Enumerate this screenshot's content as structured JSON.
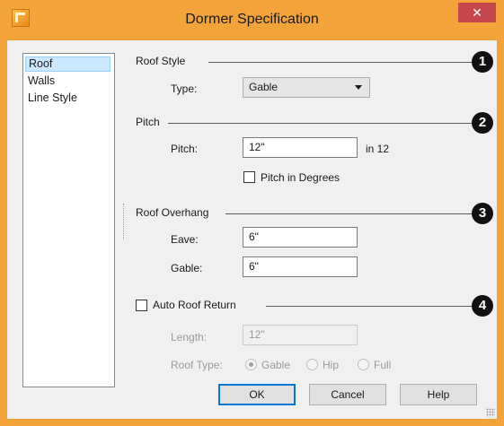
{
  "window": {
    "title": "Dormer Specification",
    "close_glyph": "✕",
    "accent_color": "#f2a33a",
    "close_color": "#c7474e"
  },
  "sidebar": {
    "items": [
      {
        "label": "Roof",
        "selected": true
      },
      {
        "label": "Walls",
        "selected": false
      },
      {
        "label": "Line Style",
        "selected": false
      }
    ]
  },
  "roof_style": {
    "heading": "Roof Style",
    "marker": "1",
    "type_label": "Type:",
    "type_value": "Gable"
  },
  "pitch": {
    "heading": "Pitch",
    "marker": "2",
    "pitch_label": "Pitch:",
    "pitch_value": "12\"",
    "pitch_suffix": "in 12",
    "degrees_label": "Pitch in Degrees",
    "degrees_checked": false
  },
  "overhang": {
    "heading": "Roof Overhang",
    "marker": "3",
    "eave_label": "Eave:",
    "eave_value": "6\"",
    "gable_label": "Gable:",
    "gable_value": "6\""
  },
  "auto_return": {
    "heading": "Auto Roof Return",
    "marker": "4",
    "checked": false,
    "length_label": "Length:",
    "length_value": "12\"",
    "roof_type_label": "Roof Type:",
    "options": [
      {
        "label": "Gable",
        "checked": true
      },
      {
        "label": "Hip",
        "checked": false
      },
      {
        "label": "Full",
        "checked": false
      }
    ]
  },
  "buttons": {
    "ok": "OK",
    "cancel": "Cancel",
    "help": "Help"
  }
}
